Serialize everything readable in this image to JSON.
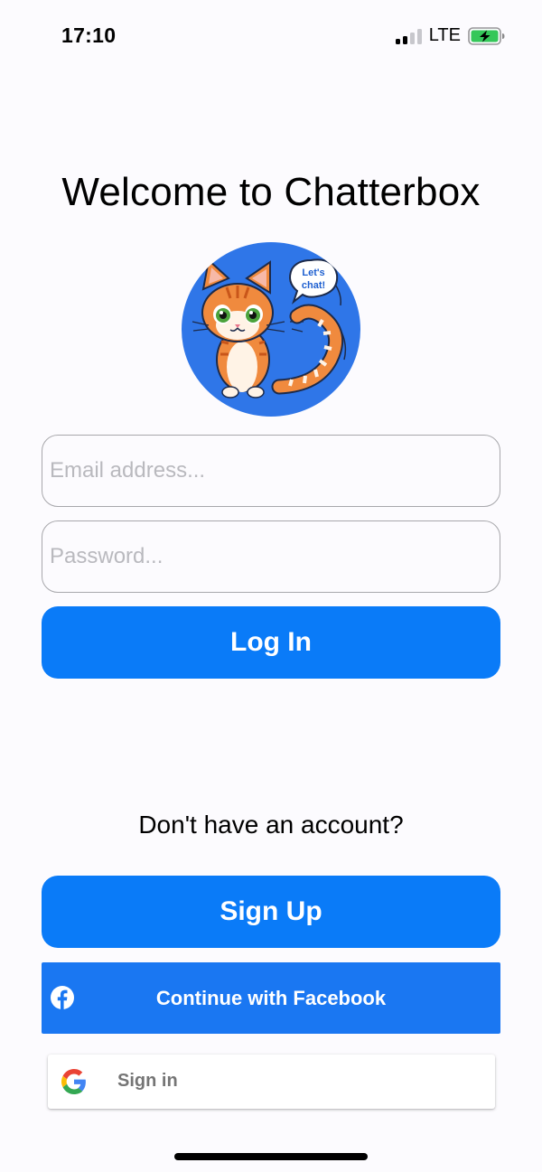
{
  "status_bar": {
    "time": "17:10",
    "network": "LTE",
    "signal_bars_active": 2,
    "signal_bars_total": 4,
    "battery_state": "charging"
  },
  "welcome": {
    "title": "Welcome to Chatterbox"
  },
  "logo": {
    "speech_bubble_line1": "Let's",
    "speech_bubble_line2": "chat!",
    "icon": "cat-mascot-icon",
    "background_color": "#2f76e8"
  },
  "login_form": {
    "email_placeholder": "Email address...",
    "email_value": "",
    "password_placeholder": "Password...",
    "password_value": "",
    "login_label": "Log In"
  },
  "signup_section": {
    "prompt": "Don't have an account?",
    "signup_label": "Sign Up"
  },
  "facebook": {
    "label": "Continue with Facebook",
    "icon": "facebook-icon",
    "color": "#1a77f2"
  },
  "google": {
    "label": "Sign in",
    "icon": "google-icon"
  },
  "colors": {
    "primary": "#0a7bf8",
    "background": "#fcfbfe"
  }
}
